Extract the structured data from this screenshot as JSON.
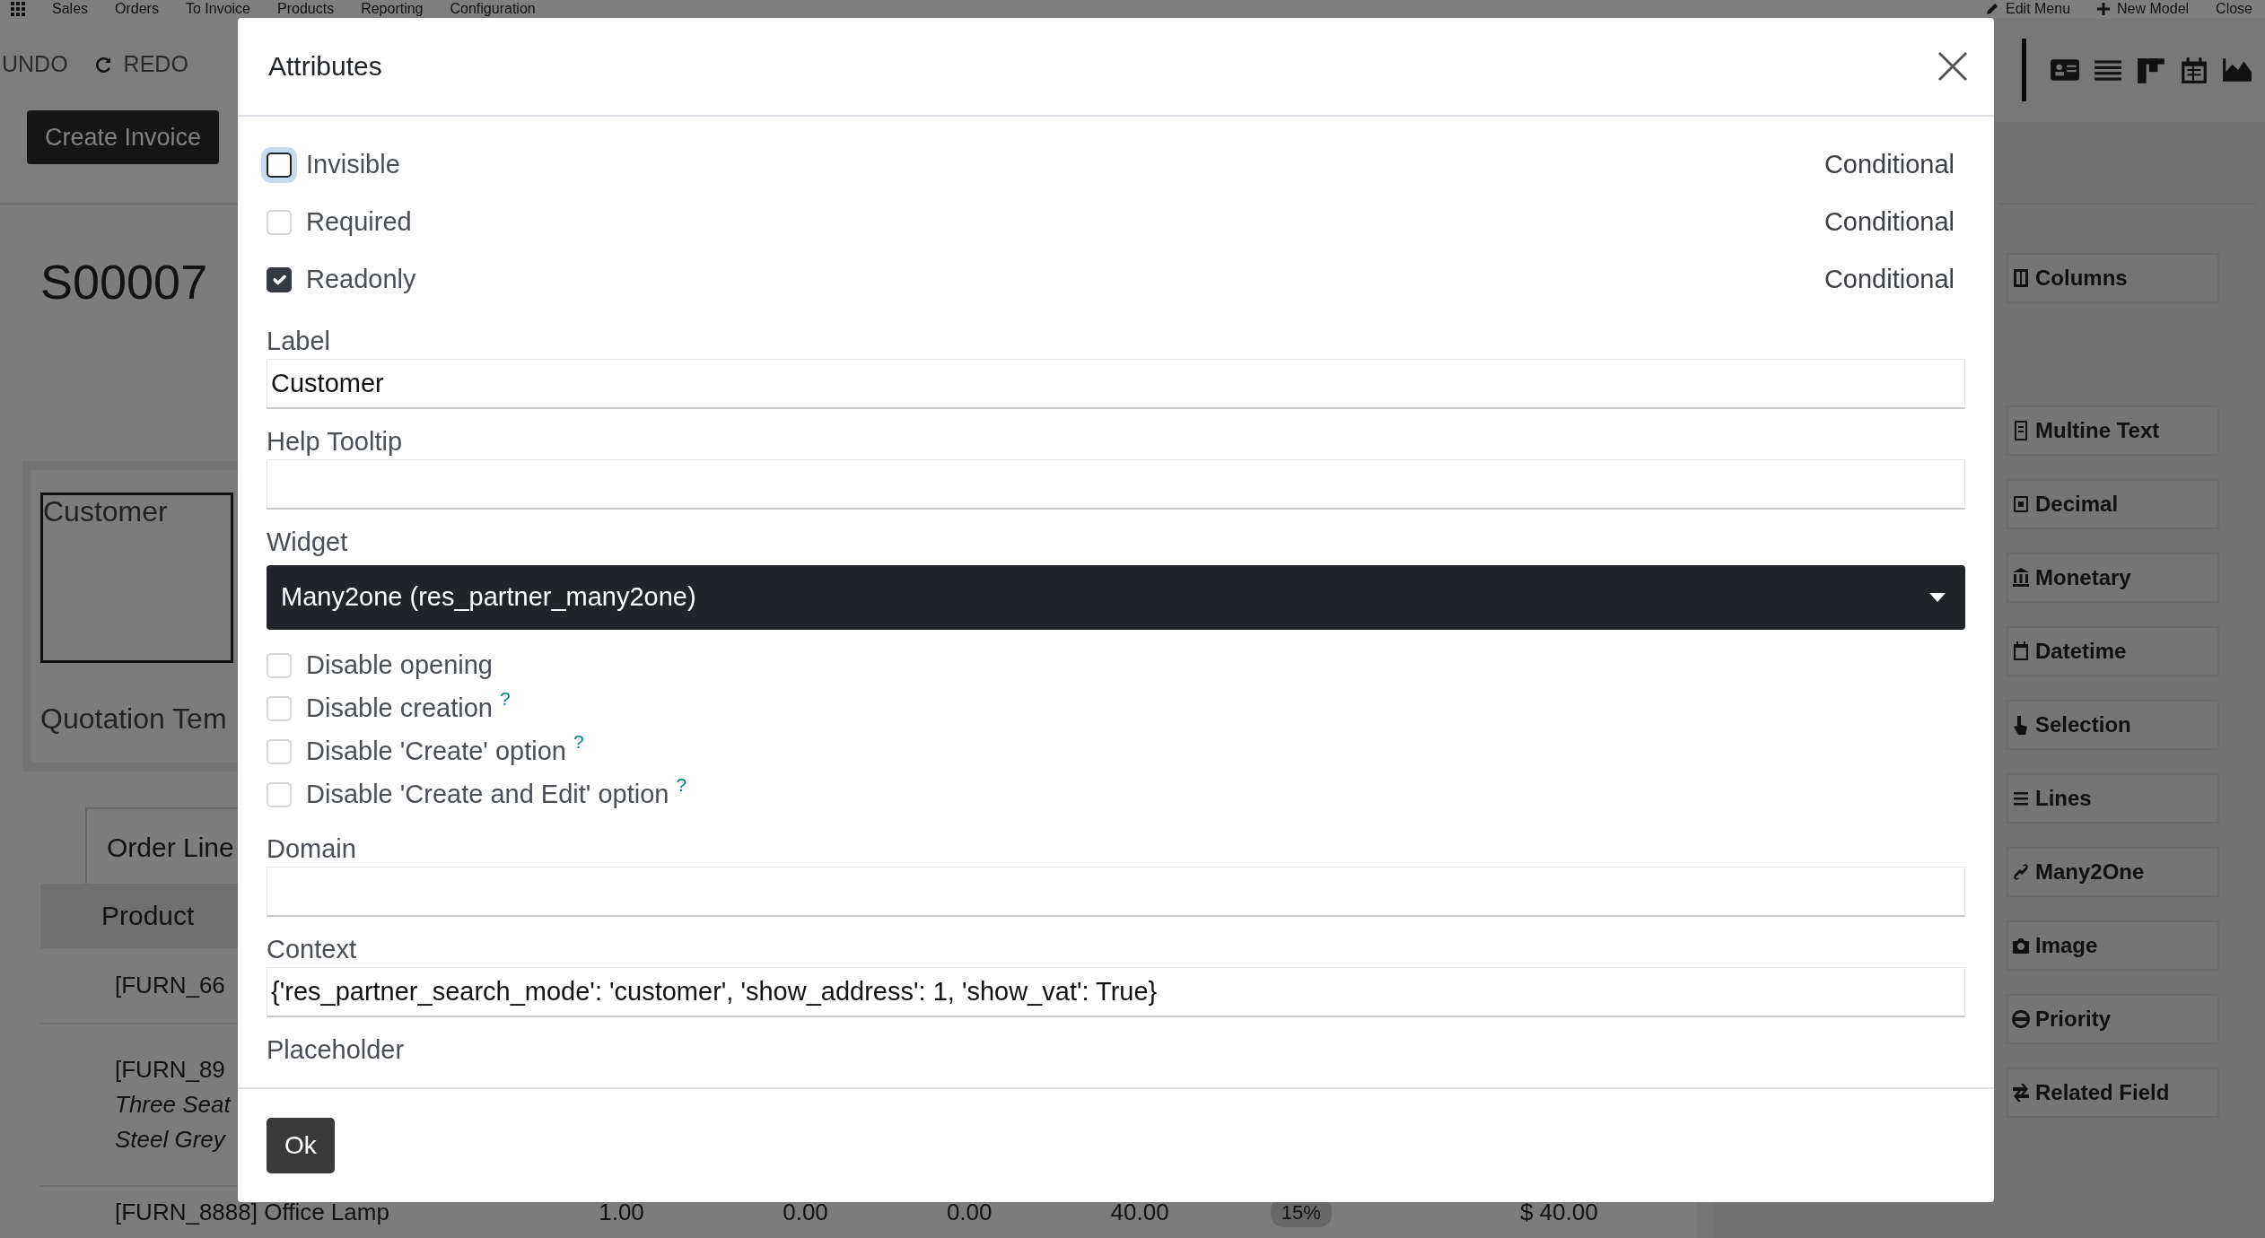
{
  "top_nav": {
    "apps": [
      "Sales",
      "Orders",
      "To Invoice",
      "Products",
      "Reporting",
      "Configuration"
    ],
    "actions": [
      "Edit Menu",
      "New Model",
      "Close"
    ]
  },
  "toolbar": {
    "undo": "UNDO",
    "redo": "REDO"
  },
  "form": {
    "action_button": "Create Invoice",
    "title": "S00007",
    "customer_label": "Customer",
    "template_label": "Quotation Tem",
    "tab": "Order Line",
    "table": {
      "columns": [
        "Product"
      ],
      "rows": [
        {
          "cells": [
            "[FURN_66"
          ]
        },
        {
          "cells": [
            "[FURN_89"
          ],
          "notes": [
            "Three Seat",
            "Steel Grey"
          ]
        },
        {
          "cells": [
            "[FURN_8888] Office Lamp",
            "1.00",
            "0.00",
            "0.00",
            "40.00",
            "15%",
            "$ 40.00"
          ]
        }
      ]
    }
  },
  "sidebar": {
    "layout_items": [
      "Columns"
    ],
    "field_items": [
      "Multine Text",
      "Decimal",
      "Monetary",
      "Datetime",
      "Selection",
      "Lines",
      "Many2One",
      "Image",
      "Priority",
      "Related Field"
    ]
  },
  "dialog": {
    "title": "Attributes",
    "attributes": [
      {
        "label": "Invisible",
        "checked": false,
        "focused": true,
        "condition": "Conditional"
      },
      {
        "label": "Required",
        "checked": false,
        "focused": false,
        "condition": "Conditional"
      },
      {
        "label": "Readonly",
        "checked": true,
        "focused": false,
        "condition": "Conditional"
      }
    ],
    "fields": [
      {
        "label": "Label",
        "value": "Customer"
      },
      {
        "label": "Help Tooltip"
      }
    ],
    "widget": {
      "label": "Widget",
      "value": "Many2one (res_partner_many2one)"
    },
    "options": [
      {
        "label": "Disable opening",
        "checked": false
      },
      {
        "label": "Disable creation",
        "checked": false,
        "help": "?"
      },
      {
        "label": "Disable 'Create' option",
        "checked": false,
        "help": "?"
      },
      {
        "label": "Disable 'Create and Edit' option",
        "checked": false,
        "help": "?"
      }
    ],
    "more_fields": [
      {
        "kind": "input",
        "label": "Domain"
      },
      {
        "kind": "input",
        "label": "Context",
        "value": "{'res_partner_search_mode': 'customer', 'show_address': 1, 'show_vat': True}"
      },
      {
        "kind": "label",
        "label": "Placeholder"
      }
    ],
    "ok_button": "Ok"
  }
}
